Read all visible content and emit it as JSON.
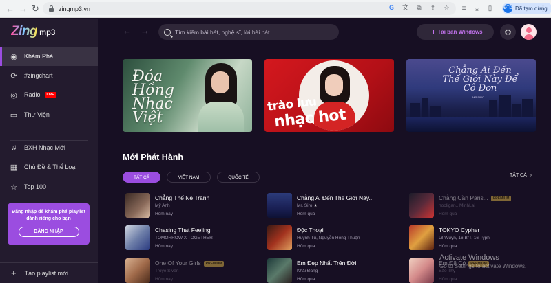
{
  "browser": {
    "url": "zingmp3.vn",
    "profile_initials": "ĐTD",
    "profile_status": "Đã tạm dừng"
  },
  "app": {
    "logo_main": "Zing",
    "logo_sub": "mp3"
  },
  "sidebar": {
    "items": [
      {
        "label": "Khám Phá",
        "icon": "disc-icon",
        "active": true
      },
      {
        "label": "#zingchart",
        "icon": "chart-line-icon"
      },
      {
        "label": "Radio",
        "icon": "radio-icon",
        "badge": "LIVE"
      },
      {
        "label": "Thư Viện",
        "icon": "library-icon"
      },
      {
        "label": "BXH Nhạc Mới",
        "icon": "music-note-icon"
      },
      {
        "label": "Chủ Đề & Thể Loại",
        "icon": "category-icon"
      },
      {
        "label": "Top 100",
        "icon": "star-icon"
      }
    ],
    "login_message": "Đăng nhập để khám phá playlist dành riêng cho bạn",
    "login_button": "ĐĂNG NHẬP",
    "new_playlist": "Tạo playlist mới"
  },
  "header": {
    "search_placeholder": "Tìm kiếm bài hát, nghệ sĩ, lời bài hát...",
    "windows_button": "Tải bản Windows"
  },
  "banners": [
    {
      "title": "Đóa Hồng Nhạc Việt"
    },
    {
      "title_line1": "trào lưu",
      "title_line2": "nhạc hot"
    },
    {
      "title": "Chẳng Ai Đến Thế Giới Này Để Cô Đơn",
      "credit": "MR.SIRO"
    }
  ],
  "new_releases": {
    "title": "Mới Phát Hành",
    "tabs": [
      "TẤT CẢ",
      "VIỆT NAM",
      "QUỐC TẾ"
    ],
    "see_all": "TẤT CẢ",
    "premium_label": "PREMIUM",
    "songs": [
      {
        "name": "Chẳng Thể Né Tránh",
        "artist": "Mỹ Anh",
        "time": "Hôm nay",
        "premium": false
      },
      {
        "name": "Chẳng Ai Đến Thế Giới Này...",
        "artist": "Mr. Siro",
        "time": "Hôm qua",
        "premium": false
      },
      {
        "name": "Chẳng Cần Paris...",
        "artist": "hooligan., MinhLai",
        "time": "Hôm qua",
        "premium": true
      },
      {
        "name": "Chasing That Feeling",
        "artist": "TOMORROW X TOGETHER",
        "time": "Hôm nay",
        "premium": false
      },
      {
        "name": "Độc Thoại",
        "artist": "Huỳnh Tú, Nguyễn Hồng Thuận",
        "time": "Hôm qua",
        "premium": false
      },
      {
        "name": "TOKYO Cypher",
        "artist": "Lil Wuyn, 16 BrT, 16 Typh",
        "time": "Hôm qua",
        "premium": false
      },
      {
        "name": "One Of Your Girls",
        "artist": "Troye Sivan",
        "time": "Hôm nay",
        "premium": true
      },
      {
        "name": "Em Đẹp Nhất Trên Đời",
        "artist": "Khải Đăng",
        "time": "Hôm qua",
        "premium": false
      },
      {
        "name": "Em Đã Có",
        "artist": "Bảo Thy",
        "time": "Hôm qua",
        "premium": true
      }
    ]
  },
  "os_overlay": {
    "line1": "Activate Windows",
    "line2": "Go to Settings to activate Windows."
  }
}
